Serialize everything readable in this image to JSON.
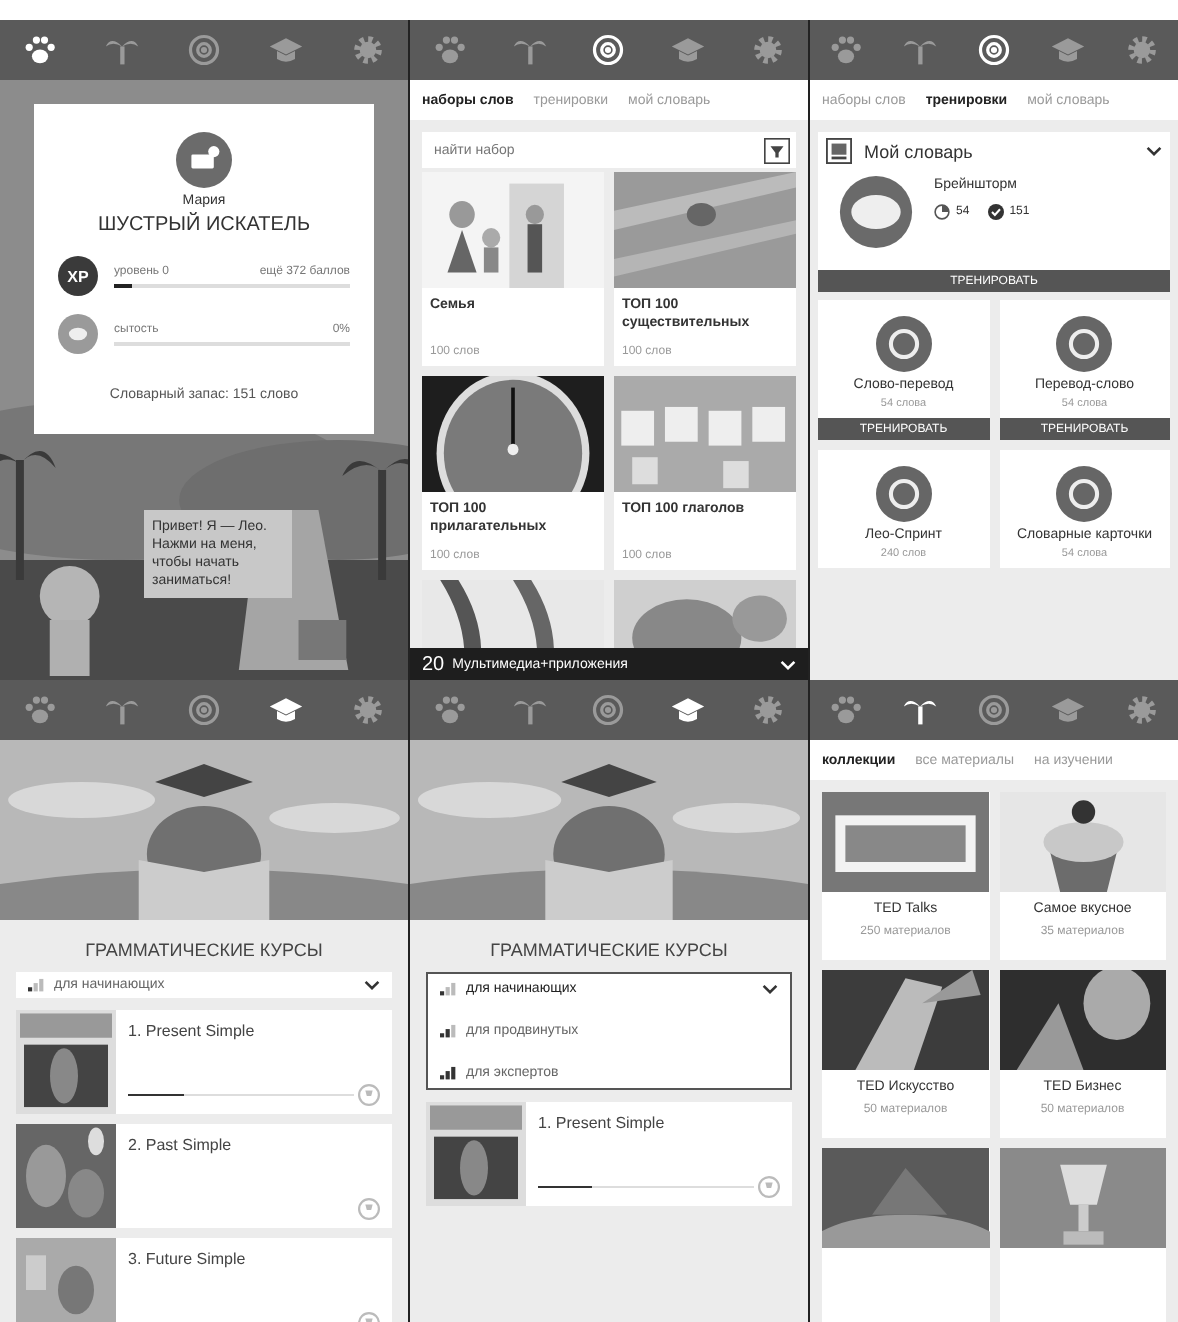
{
  "jungle": {
    "nav": [
      {
        "selected": true
      },
      {
        "selected": false
      },
      {
        "selected": false
      },
      {
        "selected": false
      },
      {
        "selected": false
      }
    ],
    "profile": {
      "name": "Мария",
      "rank": "ШУСТРЫЙ ИСКАТЕЛЬ",
      "meters": [
        {
          "kind": "xp",
          "badge": "XP",
          "label": "уровень 0",
          "reading": "ещё 372 баллов",
          "level": 0.08
        },
        {
          "kind": "food",
          "label": "сытость",
          "reading": "0%",
          "level": 0
        }
      ],
      "vocabulary": "Словарный запас: 151 слово"
    },
    "speech": "Привет! Я — Лео. Нажми на меня, чтобы начать заниматься!"
  },
  "word_sets": {
    "nav": [
      {
        "selected": false
      },
      {
        "selected": false
      },
      {
        "selected": true
      },
      {
        "selected": false
      },
      {
        "selected": false
      }
    ],
    "tabs": [
      {
        "label": "наборы слов",
        "selected": true
      },
      {
        "label": "тренировки",
        "selected": false
      },
      {
        "label": "мой словарь",
        "selected": false
      }
    ],
    "search": {
      "placeholder": "найти набор"
    },
    "cards": [
      {
        "title": "Семья",
        "count": "100 слов"
      },
      {
        "title": "ТОП 100 существительных",
        "count": "100 слов"
      },
      {
        "title": "ТОП 100 прилагательных",
        "count": "100 слов"
      },
      {
        "title": "ТОП 100 глаголов",
        "count": "100 слов"
      }
    ],
    "dropdown": {
      "badge": "20",
      "label": "Мультимедиа+приложения"
    }
  },
  "trainings": {
    "nav": [
      {
        "selected": false
      },
      {
        "selected": false
      },
      {
        "selected": true
      },
      {
        "selected": false
      },
      {
        "selected": false
      }
    ],
    "tabs": [
      {
        "label": "наборы слов",
        "selected": false
      },
      {
        "label": "тренировки",
        "selected": true
      },
      {
        "label": "мой словарь",
        "selected": false
      }
    ],
    "dictionary": {
      "label": "Мой словарь"
    },
    "featured": {
      "title": "Брейншторм",
      "stats": [
        "54",
        "151"
      ],
      "button": "ТРЕНИРОВАТЬ"
    },
    "modes": [
      {
        "title": "Слово-перевод",
        "count": "54 слова",
        "button": "ТРЕНИРОВАТЬ"
      },
      {
        "title": "Перевод-слово",
        "count": "54 слова",
        "button": "ТРЕНИРОВАТЬ"
      },
      {
        "title": "Лео-Спринт",
        "count": "240 слов"
      },
      {
        "title": "Словарные карточки",
        "count": "54 слова"
      }
    ]
  },
  "grammar": {
    "nav": [
      {
        "selected": false
      },
      {
        "selected": false
      },
      {
        "selected": false
      },
      {
        "selected": true
      },
      {
        "selected": false
      }
    ],
    "title": "ГРАММАТИЧЕСКИЕ КУРСЫ",
    "expanded": false,
    "levels": [
      {
        "label": "для начинающих",
        "selected": true
      }
    ],
    "lessons": [
      {
        "title": "1. Present Simple",
        "level": 0.25
      },
      {
        "title": "2. Past Simple"
      },
      {
        "title": "3. Future Simple"
      }
    ]
  },
  "grammar_open": {
    "nav": [
      {
        "selected": false
      },
      {
        "selected": false
      },
      {
        "selected": false
      },
      {
        "selected": true
      },
      {
        "selected": false
      }
    ],
    "title": "ГРАММАТИЧЕСКИЕ КУРСЫ",
    "expanded": true,
    "levels": [
      {
        "label": "для начинающих",
        "selected": true
      },
      {
        "label": "для продвинутых",
        "selected": false
      },
      {
        "label": "для экспертов",
        "selected": false
      }
    ],
    "lessons": [
      {
        "title": "1. Present Simple",
        "level": 0.25
      }
    ]
  },
  "collections": {
    "nav": [
      {
        "selected": false
      },
      {
        "selected": true
      },
      {
        "selected": false
      },
      {
        "selected": false
      },
      {
        "selected": false
      }
    ],
    "tabs": [
      {
        "label": "коллекции",
        "selected": true
      },
      {
        "label": "все материалы",
        "selected": false
      },
      {
        "label": "на изучении",
        "selected": false
      }
    ],
    "cards": [
      {
        "title": "TED Talks",
        "count": "250 материалов"
      },
      {
        "title": "Самое вкусное",
        "count": "35 материалов"
      },
      {
        "title": "TED Искусство",
        "count": "50 материалов"
      },
      {
        "title": "TED Бизнес",
        "count": "50 материалов"
      }
    ]
  }
}
